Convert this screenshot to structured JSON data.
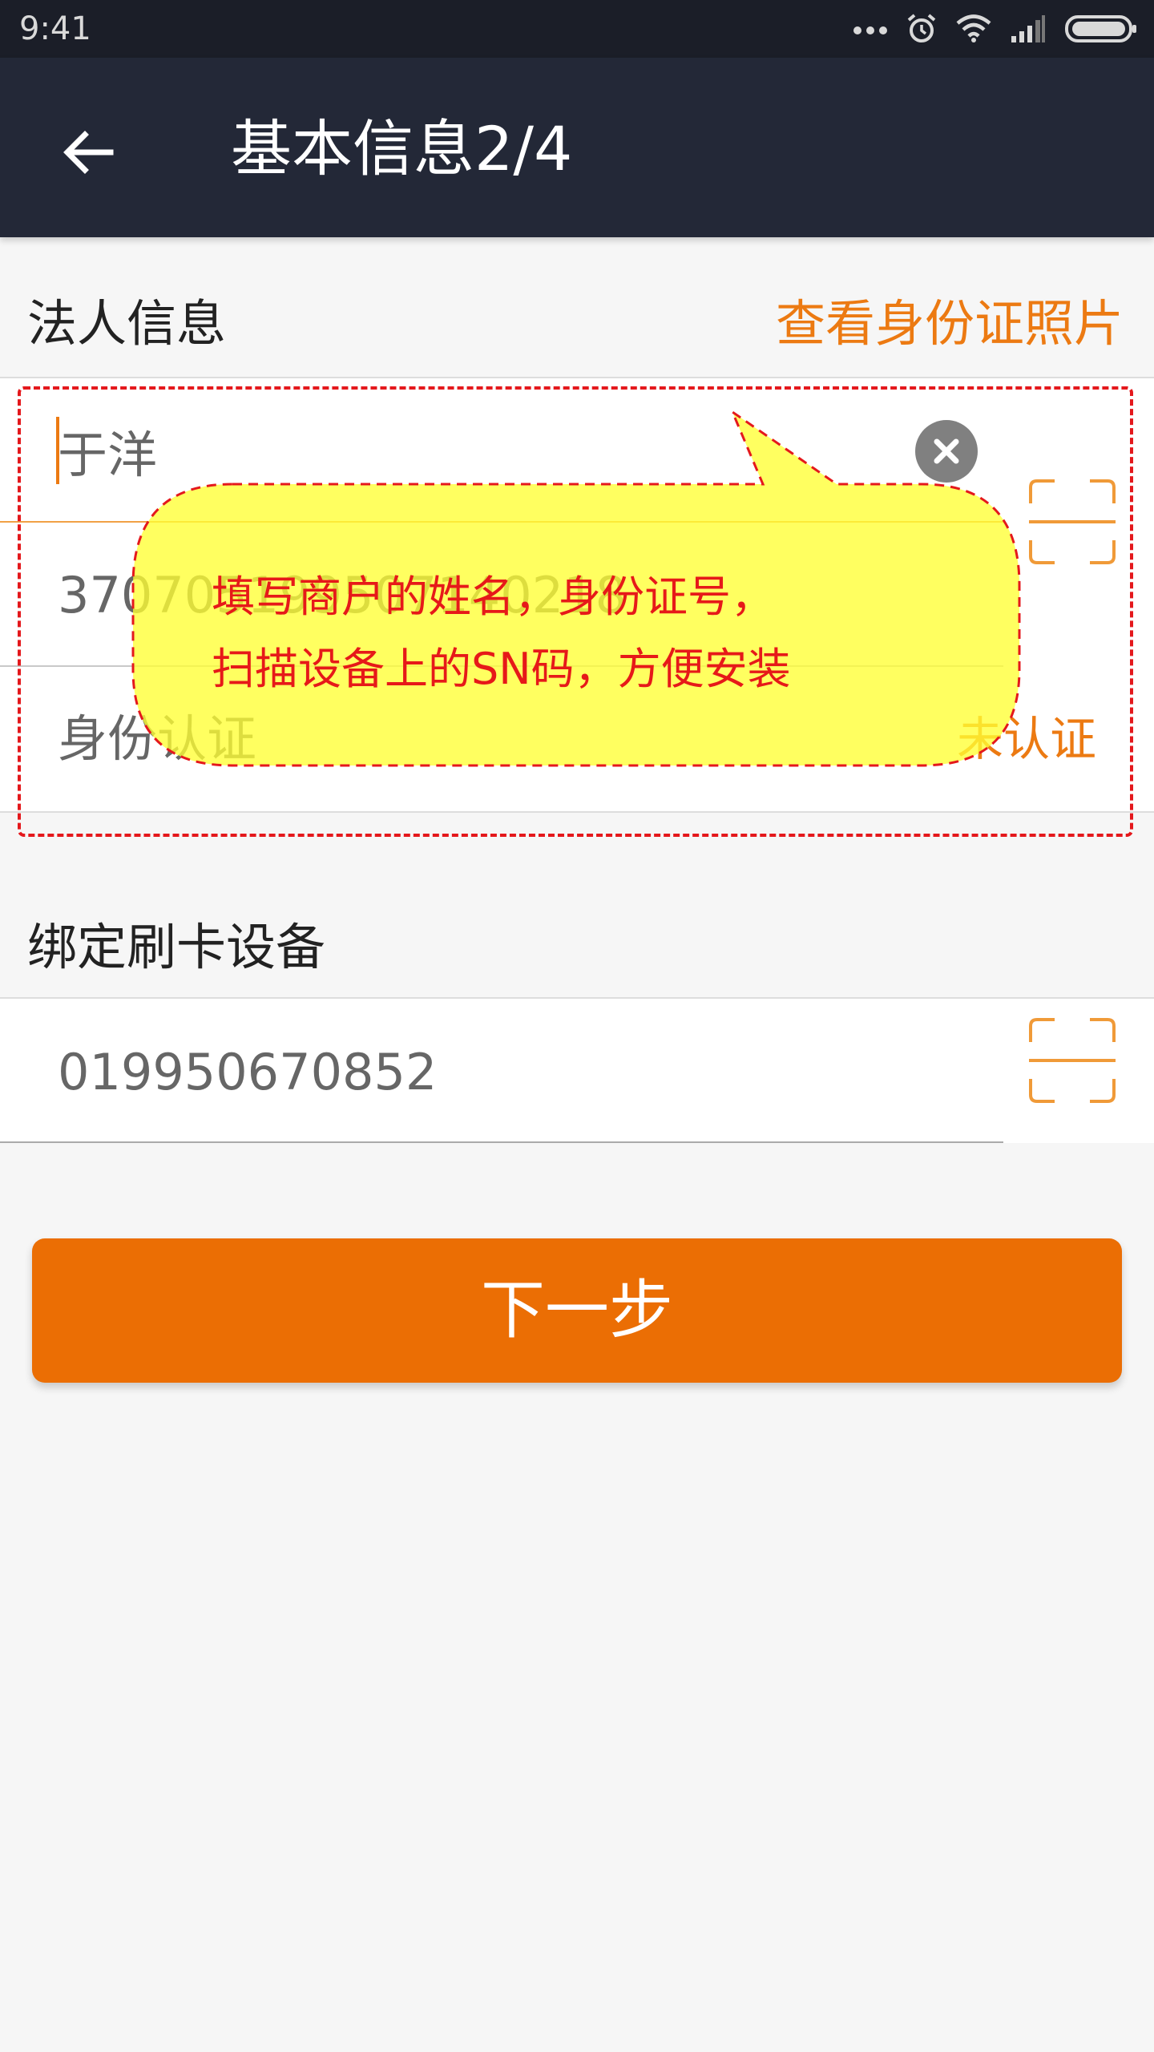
{
  "status_bar": {
    "time": "9:41"
  },
  "app_bar": {
    "title": "基本信息2/4",
    "back_icon": "back-arrow-icon"
  },
  "legal_section": {
    "title": "法人信息",
    "link": "查看身份证照片",
    "name_value": "于洋",
    "id_value": "370705199507140218",
    "verify_label": "身份认证",
    "verify_status": "未认证"
  },
  "device_section": {
    "title": "绑定刷卡设备",
    "sn_value": "019950670852"
  },
  "next_button": {
    "label": "下一步"
  },
  "annotation": {
    "line1": "填写商户的姓名，身份证号，",
    "line2": "扫描设备上的SN码，方便安装"
  },
  "colors": {
    "accent": "#eb6e04",
    "app_bar": "#232837",
    "annotation_fill": "#ffff66",
    "annotation_border": "#e4181c"
  }
}
